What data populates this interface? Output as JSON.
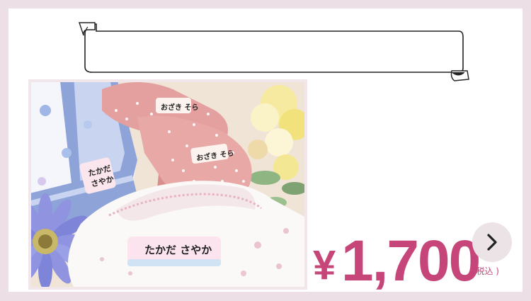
{
  "product": {
    "price_symbol": "¥",
    "price_amount": "1,700",
    "tax_note": "( 税込 )"
  },
  "photo_labels": {
    "socks_top": "おざき そら",
    "socks_bottom": "おざき そら",
    "towel_line1": "たかだ",
    "towel_line2": "さやか",
    "shirt": "たかだ さやか"
  },
  "colors": {
    "accent": "#c6467a",
    "frame": "#ece0e6",
    "sock": "#e5a3a2",
    "towel": "#8fa6d8"
  },
  "icons": {
    "next": "chevron-right-icon"
  }
}
